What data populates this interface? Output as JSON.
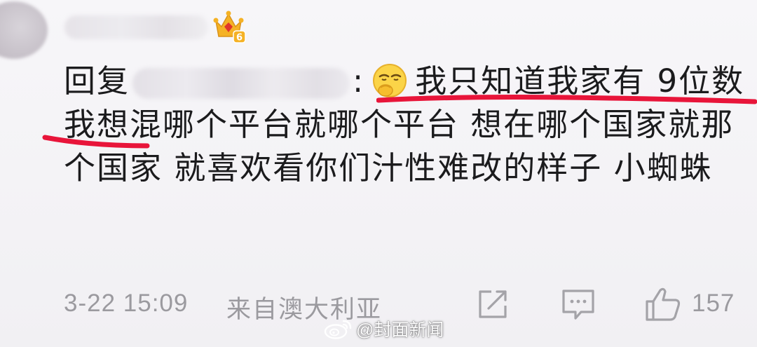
{
  "comment": {
    "reply_label": "回复",
    "colon": ":",
    "body_line1": "我只知道我家有 9",
    "body_rest": "位数 我想混哪个平台就哪个平台 想在哪个国家就那个国家 就喜欢看你们汁性难改的样子 小蜘蛛",
    "user_level_badge": "6",
    "emoji_name": "smirk-hand-emoji"
  },
  "meta": {
    "timestamp": "3-22 15:09",
    "source": "来自澳大利亚",
    "like_count": "157"
  },
  "watermark": {
    "text": "@封面新闻"
  },
  "colors": {
    "annotation_red": "#e8153a",
    "badge_gold": "#f5b225",
    "badge_red": "#e0362b",
    "meta_gray": "#9b9a9f",
    "text_dark": "#1b1b1d"
  }
}
